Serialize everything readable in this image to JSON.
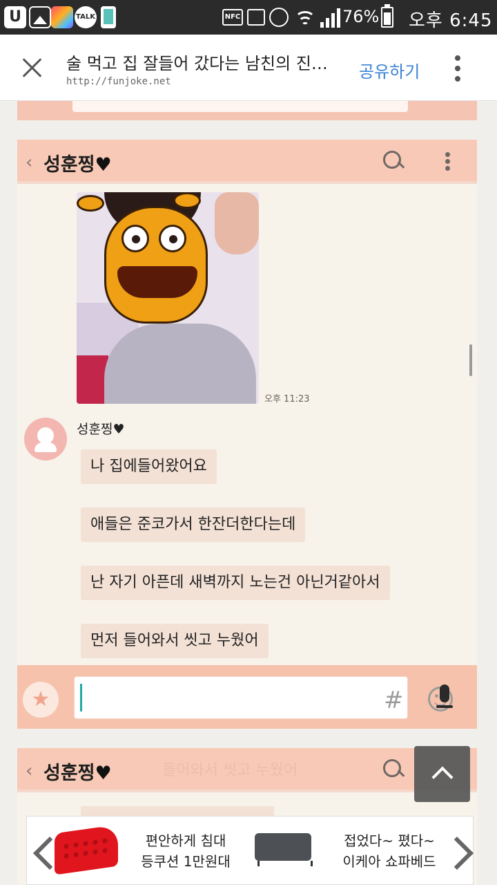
{
  "status_bar": {
    "nfc_label": "NFC",
    "talk_label": "TALK",
    "u_label": "U",
    "battery_percent": "76%",
    "time": "오후 6:45"
  },
  "browser": {
    "title": "술 먹고 집 잘들어 갔다는 남친의 진…",
    "url": "http://funjoke.net",
    "share_label": "공유하기"
  },
  "chat": {
    "room_name": "성훈찡",
    "heart": "♥",
    "back_glyph": "‹",
    "photo_time": "오후 11:23",
    "sender": "성훈찡♥",
    "messages": [
      "나 집에들어왔어요",
      "애들은 준코가서 한잔더한다는데",
      "난 자기 아픈데 새벽까지 노는건 아닌거같아서",
      "먼저 들어와서 씻고 누웠어"
    ],
    "input_hash": "#",
    "ghost_text": "들어와서 씻고 누웠어"
  },
  "ad": {
    "left_line1": "편안하게 침대",
    "left_line2": "등쿠션 1만원대",
    "right_line1": "접었다~ 폈다~",
    "right_line2": "이케아 쇼파베드"
  }
}
